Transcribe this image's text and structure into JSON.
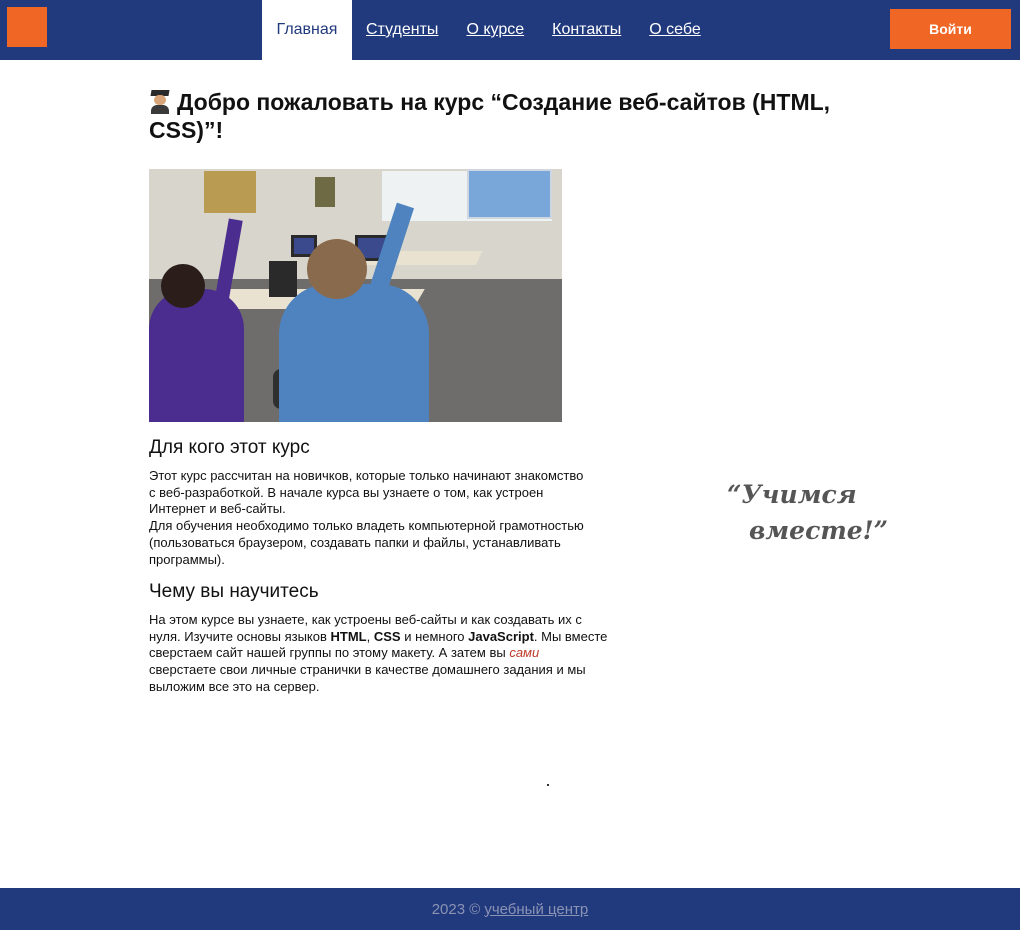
{
  "header": {
    "nav": [
      {
        "label": "Главная",
        "active": true
      },
      {
        "label": "Студенты",
        "active": false
      },
      {
        "label": "О курсе",
        "active": false
      },
      {
        "label": "Контакты",
        "active": false
      },
      {
        "label": "О себе",
        "active": false
      }
    ],
    "login_label": "Войти"
  },
  "main": {
    "title": "Добро пожаловать на курс “Создание веб-сайтов (HTML, CSS)”!",
    "title_icon": "student-icon",
    "for_whom": {
      "heading": "Для кого этот курс",
      "line1": "Этот курс рассчитан на новичков, которые только начинают знакомство",
      "line2": "с веб-разработкой. В начале курса вы узнаете о том, как устроен",
      "line3": "Интернет и веб-сайты.",
      "line4": "Для обучения необходимо только владеть компьютерной грамотностью",
      "line5": "(пользоваться браузером, создавать папки и файлы, устанавливать",
      "line6": "программы)."
    },
    "learn": {
      "heading": "Чему вы научитесь",
      "line1": "На этом курсе вы узнаете, как устроены веб-сайты и как создавать их с",
      "line2_a": "нуля. Изучите основы языков ",
      "line2_html": "HTML",
      "line2_comma": ", ",
      "line2_css": "CSS",
      "line2_b": " и немного ",
      "line2_js": "JavaScript",
      "line2_c": ". Мы вместе",
      "line3_a": "сверстаем сайт нашей группы по этому макету. А затем вы ",
      "line3_em": "сами",
      "line4": "сверстаете свои личные странички в качестве домашнего задания и мы",
      "line5": "выложим все это на сервер."
    }
  },
  "aside": {
    "quote_line1": "“Учимся",
    "quote_line2": "вместе!”"
  },
  "footer": {
    "copyright": "2023 ©",
    "link": "учебный центр"
  },
  "colors": {
    "header_bg": "#213a7d",
    "accent": "#ef6625",
    "footer_text": "#8b93b5"
  }
}
